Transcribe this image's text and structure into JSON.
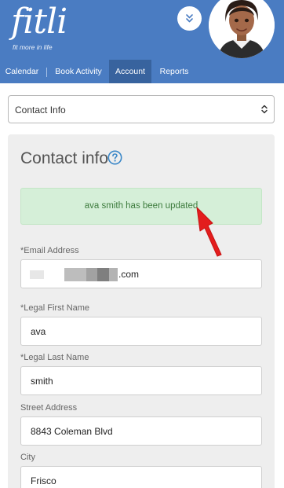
{
  "brand": {
    "logo_text": "fitli",
    "tagline": "fit more in life"
  },
  "nav": {
    "tabs": [
      {
        "label": "Calendar"
      },
      {
        "label": "Book Activity"
      },
      {
        "label": "Account"
      },
      {
        "label": "Reports"
      }
    ],
    "active_tab": "Account"
  },
  "section_select": {
    "selected": "Contact Info"
  },
  "panel": {
    "title": "Contact info",
    "alert": "ava smith has been updated"
  },
  "form": {
    "email": {
      "label": "*Email Address",
      "value_suffix": ".com"
    },
    "first_name": {
      "label": "*Legal First Name",
      "value": "ava"
    },
    "last_name": {
      "label": "*Legal Last Name",
      "value": "smith"
    },
    "street": {
      "label": "Street Address",
      "value": "8843 Coleman Blvd"
    },
    "city": {
      "label": "City",
      "value": "Frisco"
    }
  },
  "colors": {
    "header": "#4a7cc2",
    "active_tab": "#38639e",
    "alert_bg": "#d5efd8",
    "alert_text": "#3d7b3d",
    "annotation_arrow": "#e31d1d"
  },
  "icons": {
    "expand": "double-chevron-down-icon",
    "help": "question-circle-icon",
    "select": "chevron-up-down-icon"
  }
}
